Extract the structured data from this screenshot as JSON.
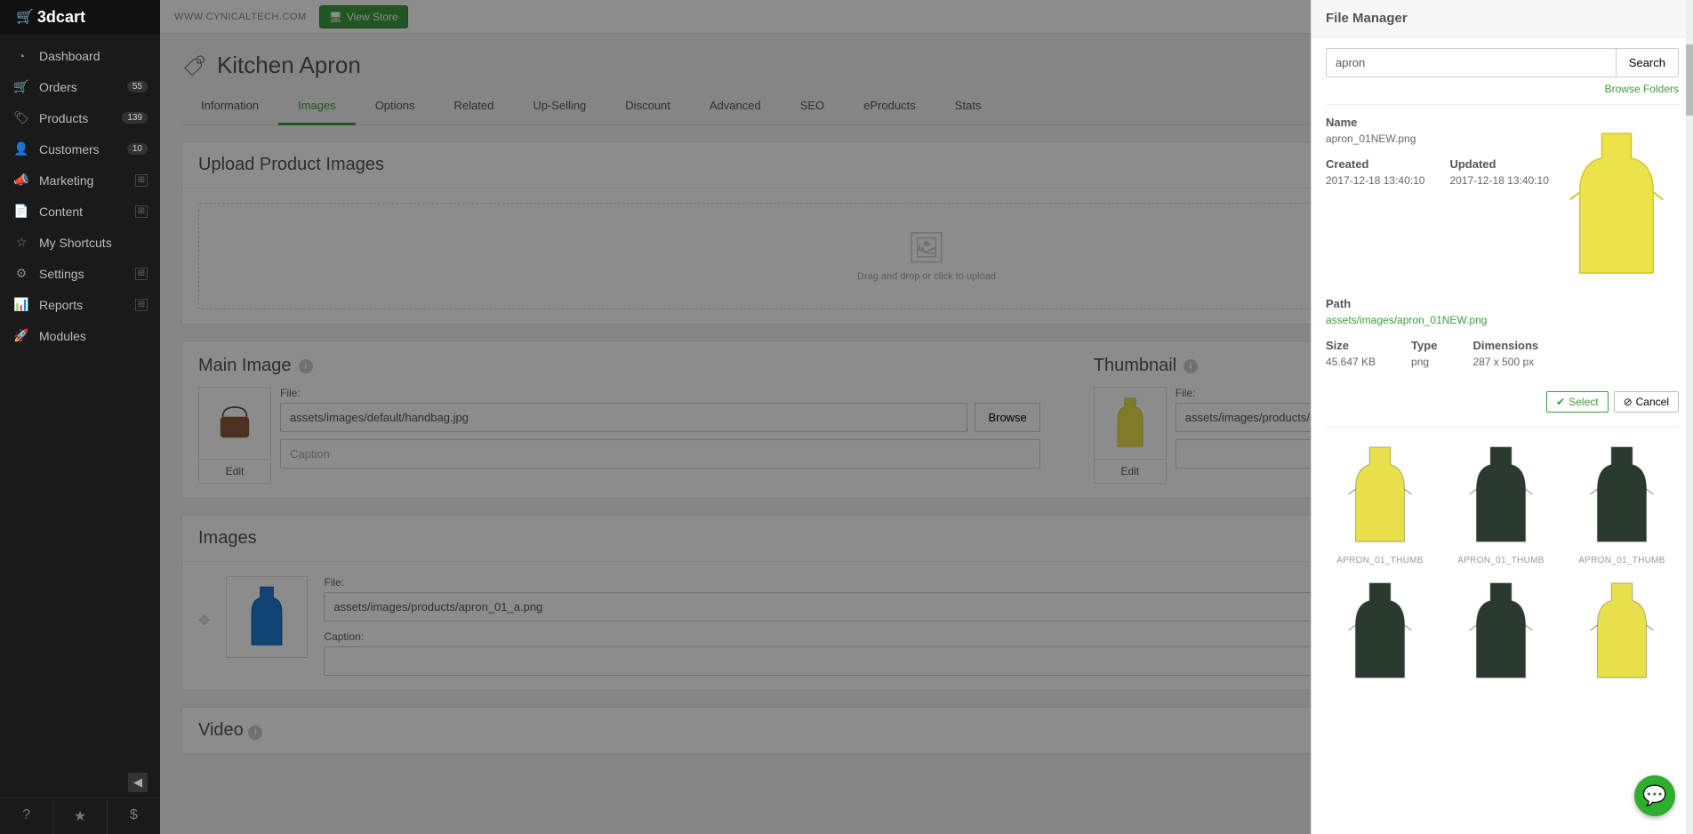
{
  "brand": {
    "name": "3dcart"
  },
  "topbar": {
    "store_url": "WWW.CYNICALTECH.COM",
    "view_store": "View Store"
  },
  "sidebar": {
    "items": [
      {
        "label": "Dashboard",
        "icon": "◔"
      },
      {
        "label": "Orders",
        "icon": "🛒",
        "badge": "55"
      },
      {
        "label": "Products",
        "icon": "🏷",
        "badge": "139"
      },
      {
        "label": "Customers",
        "icon": "👤",
        "badge": "10"
      },
      {
        "label": "Marketing",
        "icon": "📣",
        "expand": true
      },
      {
        "label": "Content",
        "icon": "📄",
        "expand": true
      },
      {
        "label": "My Shortcuts",
        "icon": "☆"
      },
      {
        "label": "Settings",
        "icon": "⚙",
        "expand": true
      },
      {
        "label": "Reports",
        "icon": "📊",
        "expand": true
      },
      {
        "label": "Modules",
        "icon": "🚀"
      }
    ]
  },
  "page": {
    "title": "Kitchen Apron"
  },
  "tabs": [
    "Information",
    "Images",
    "Options",
    "Related",
    "Up-Selling",
    "Discount",
    "Advanced",
    "SEO",
    "eProducts",
    "Stats"
  ],
  "active_tab": "Images",
  "upload": {
    "heading": "Upload Product Images",
    "hint": "Drag and drop or click to upload"
  },
  "main_image": {
    "heading": "Main Image",
    "file_label": "File:",
    "file_value": "assets/images/default/handbag.jpg",
    "caption_placeholder": "Caption",
    "browse": "Browse",
    "edit": "Edit"
  },
  "thumbnail": {
    "heading": "Thumbnail",
    "file_label": "File:",
    "file_value": "assets/images/products/ap",
    "edit": "Edit"
  },
  "images_section": {
    "heading": "Images",
    "file_label": "File:",
    "file_value": "assets/images/products/apron_01_a.png",
    "caption_label": "Caption:"
  },
  "video_section": {
    "heading": "Video"
  },
  "file_manager": {
    "title": "File Manager",
    "search_value": "apron",
    "search_button": "Search",
    "browse_folders": "Browse Folders",
    "labels": {
      "name": "Name",
      "created": "Created",
      "updated": "Updated",
      "path": "Path",
      "size": "Size",
      "type": "Type",
      "dimensions": "Dimensions"
    },
    "detail": {
      "name": "apron_01NEW.png",
      "created": "2017-12-18 13:40:10",
      "updated": "2017-12-18 13:40:10",
      "path": "assets/images/apron_01NEW.png",
      "size": "45.647 KB",
      "type": "png",
      "dimensions": "287 x 500 px"
    },
    "select": "Select",
    "cancel": "Cancel",
    "tiles": [
      {
        "name": "APRON_01_THUMB",
        "color": "#e8e04a"
      },
      {
        "name": "APRON_01_THUMB",
        "color": "#2b3a2f"
      },
      {
        "name": "APRON_01_THUMB",
        "color": "#2b3a2f"
      },
      {
        "name": "",
        "color": "#2b3a2f"
      },
      {
        "name": "",
        "color": "#2b3a2f"
      },
      {
        "name": "",
        "color": "#e8e04a"
      }
    ]
  }
}
